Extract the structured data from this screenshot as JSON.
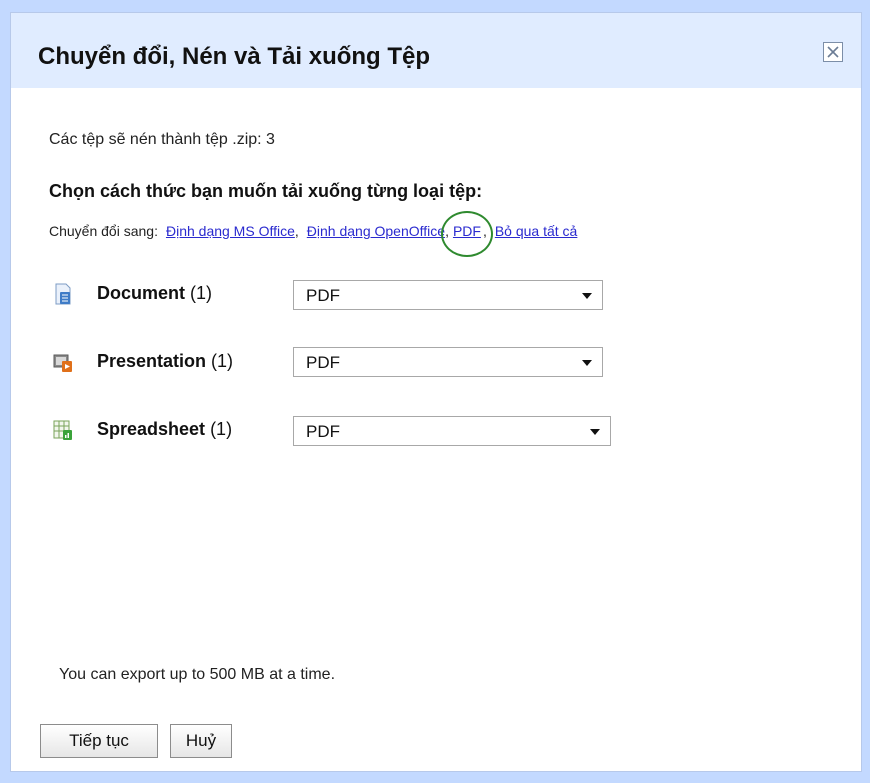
{
  "dialog": {
    "title": "Chuyển đổi, Nén và Tải xuống Tệp",
    "close_icon": "close-icon"
  },
  "main": {
    "file_count_text": "Các tệp sẽ nén thành tệp .zip: 3",
    "heading": "Chọn cách thức bạn muốn tải xuống từng loại tệp:",
    "convert_label": "Chuyển đổi sang:",
    "convert_links": {
      "ms_office": "Định dạng MS Office",
      "open_office": "Định dạng OpenOffice",
      "pdf": "PDF",
      "skip_all": "Bỏ qua tất cả"
    },
    "file_types": [
      {
        "name": "Document",
        "count": "(1)",
        "icon": "document-icon",
        "format": "PDF"
      },
      {
        "name": "Presentation",
        "count": "(1)",
        "icon": "presentation-icon",
        "format": "PDF"
      },
      {
        "name": "Spreadsheet",
        "count": "(1)",
        "icon": "spreadsheet-icon",
        "format": "PDF"
      }
    ],
    "limit_text": "You can export up to 500 MB at a time."
  },
  "footer": {
    "continue_label": "Tiếp tục",
    "cancel_label": "Huỷ"
  },
  "colors": {
    "background": "#c3d9ff",
    "titlebar": "#e0ecff",
    "link": "#2a2acf",
    "highlight_circle": "#2f8a2f"
  }
}
